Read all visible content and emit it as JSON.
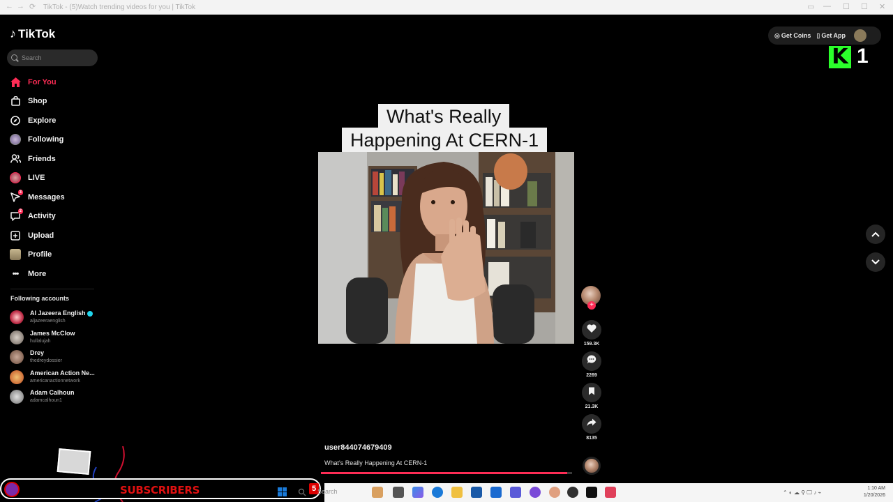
{
  "browser": {
    "back": "←",
    "forward": "→",
    "reload": "⟳",
    "tab_title": "TikTok - (5)Watch trending videos for you | TikTok",
    "minimize": "—",
    "maximize": "☐",
    "close": "✕"
  },
  "app": {
    "brand": "TikTok",
    "brand_color": "#fe2c55"
  },
  "search": {
    "placeholder": "Search"
  },
  "sidebar": {
    "items": [
      {
        "label": "For You",
        "icon": "home-icon",
        "active": true
      },
      {
        "label": "Shop",
        "icon": "shopping-bag-icon"
      },
      {
        "label": "Explore",
        "icon": "compass-icon"
      },
      {
        "label": "Following",
        "icon": "following-avatar-icon"
      },
      {
        "label": "Friends",
        "icon": "friends-icon"
      },
      {
        "label": "LIVE",
        "icon": "live-icon"
      },
      {
        "label": "Messages",
        "icon": "paper-plane-icon",
        "badge": "3"
      },
      {
        "label": "Activity",
        "icon": "inbox-icon",
        "badge": "2"
      },
      {
        "label": "Upload",
        "icon": "plus-square-icon"
      },
      {
        "label": "Profile",
        "icon": "profile-avatar-icon"
      },
      {
        "label": "More",
        "icon": "ellipsis-icon"
      }
    ],
    "following_title": "Following accounts",
    "accounts": [
      {
        "name": "Al Jazeera English",
        "handle": "aljazeeraenglish",
        "verified": true
      },
      {
        "name": "James McClow",
        "handle": "hullalujah"
      },
      {
        "name": "Drey",
        "handle": "thedreydossier"
      },
      {
        "name": "American Action Ne...",
        "handle": "americanactionnetwork"
      },
      {
        "name": "Adam Calhoun",
        "handle": "adamcalhoun1"
      }
    ]
  },
  "topbar": {
    "get_coins": "Get Coins",
    "get_app": "Get App"
  },
  "overlay_logo": {
    "letter": "K",
    "number": "1"
  },
  "video": {
    "caption_line1": "What's Really",
    "caption_line2": "Happening At CERN-1",
    "username": "user844074679409",
    "description": "What's Really Happening At CERN-1",
    "progress": 0.98
  },
  "actions": {
    "likes": "159.3K",
    "comments": "2269",
    "saves": "21.3K",
    "shares": "8135"
  },
  "stream_overlay": {
    "subscribers": "SUBSCRIBERS",
    "count": "5"
  },
  "taskbar": {
    "search_placeholder": "Search",
    "time": "1:10 AM",
    "date": "1/20/2026"
  }
}
